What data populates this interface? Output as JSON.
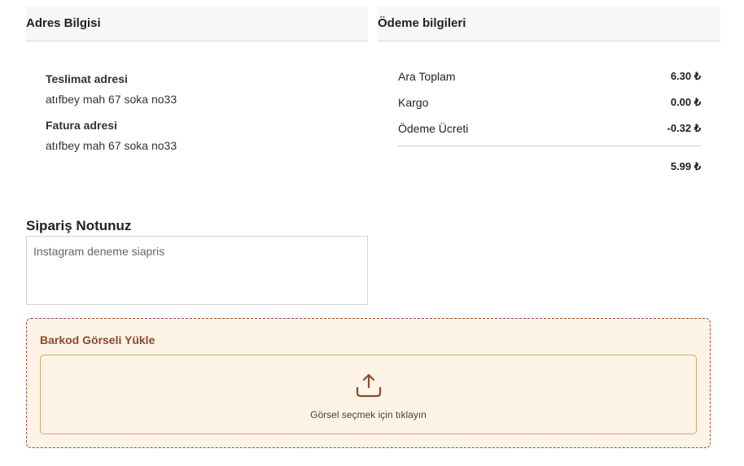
{
  "address": {
    "header": "Adres Bilgisi",
    "delivery_label": "Teslimat adresi",
    "delivery_value": "atıfbey mah 67 soka no33",
    "billing_label": "Fatura adresi",
    "billing_value": "atıfbey mah 67 soka no33"
  },
  "payment": {
    "header": "Ödeme bilgileri",
    "rows": [
      {
        "label": "Ara Toplam",
        "amount": "6.30 ₺"
      },
      {
        "label": "Kargo",
        "amount": "0.00 ₺"
      },
      {
        "label": "Ödeme Ücreti",
        "amount": "-0.32 ₺"
      }
    ],
    "total": "5.99 ₺"
  },
  "note": {
    "title": "Sipariş Notunuz",
    "value": "Instagram deneme siapris"
  },
  "barcode": {
    "title": "Barkod Görseli Yükle",
    "upload_text": "Görsel seçmek için tıklayın",
    "icon": "upload-icon"
  },
  "colors": {
    "accent": "#8a4a2d",
    "upload_bg": "#fdf3e7",
    "upload_border": "#d7a873"
  }
}
